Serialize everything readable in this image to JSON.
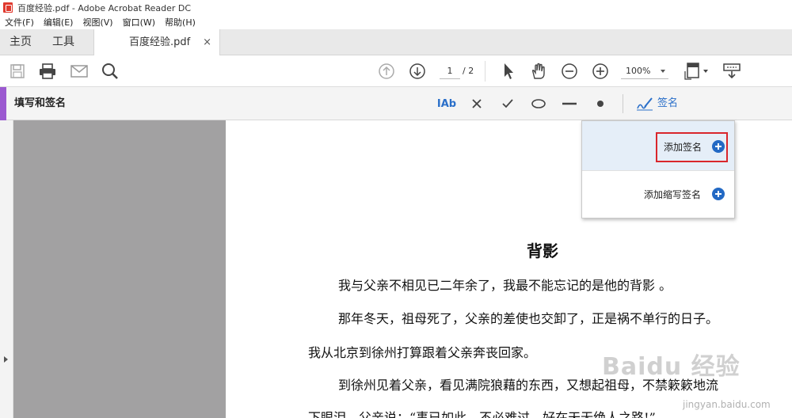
{
  "window": {
    "title": "百度经验.pdf - Adobe Acrobat Reader DC"
  },
  "menu": {
    "items": [
      "文件(F)",
      "编辑(E)",
      "视图(V)",
      "窗口(W)",
      "帮助(H)"
    ]
  },
  "tabs": {
    "home": "主页",
    "tools": "工具",
    "document": "百度经验.pdf",
    "close": "×"
  },
  "toolbar": {
    "icons": [
      "save-icon",
      "print-icon",
      "email-icon",
      "search-icon",
      "prev-page-icon",
      "next-page-icon",
      "select-arrow-icon",
      "hand-icon",
      "zoom-out-icon",
      "zoom-in-icon",
      "fit-page-icon",
      "keyboard-icon"
    ],
    "page_current": "1",
    "page_total": "/ 2",
    "zoom": "100%"
  },
  "fill_sign": {
    "title": "填写和签名",
    "text_tool": "IAb",
    "sign_label": "签名",
    "accent_color": "#9b59d0",
    "sign_color": "#2a6fc9"
  },
  "sign_menu": {
    "add_signature": "添加签名",
    "add_initials": "添加缩写签名",
    "highlight_color": "#d9262c"
  },
  "document": {
    "title": "背影",
    "paragraphs": [
      "我与父亲不相见已二年余了，我最不能忘记的是他的背影 。",
      "那年冬天，祖母死了，父亲的差使也交卸了，正是祸不单行的日子。",
      "我从北京到徐州打算跟着父亲奔丧回家。",
      "到徐州见着父亲，看见满院狼藉的东西，又想起祖母，不禁簌簌地流",
      "下眼泪。父亲说：“事已如此，不必难过，好在天无绝人之路!”"
    ]
  },
  "watermark": {
    "brand": "Baidu 经验",
    "url": "jingyan.baidu.com"
  }
}
